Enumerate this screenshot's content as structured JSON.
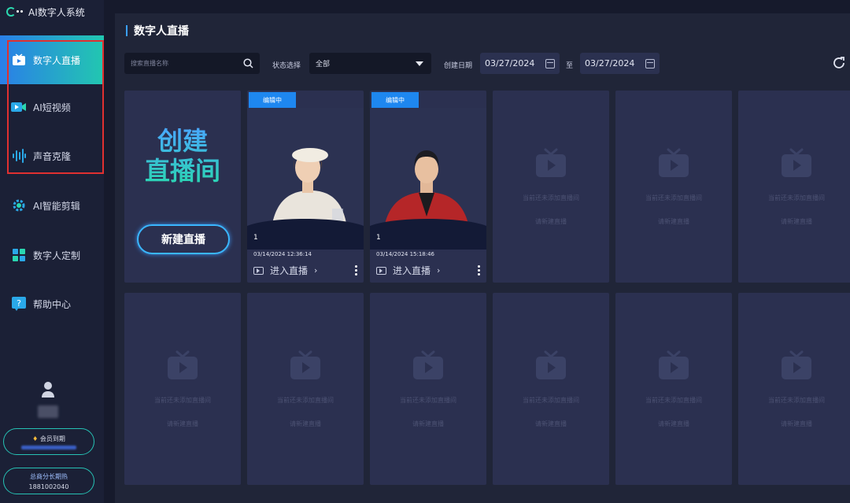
{
  "app": {
    "title": "AI数字人系统"
  },
  "sidebar": {
    "items": [
      {
        "label": "数字人直播",
        "icon": "live-tv-icon"
      },
      {
        "label": "AI短视频",
        "icon": "video-camera-icon"
      },
      {
        "label": "声音克隆",
        "icon": "sound-wave-icon"
      },
      {
        "label": "AI智能剪辑",
        "icon": "gear-icon"
      },
      {
        "label": "数字人定制",
        "icon": "puzzle-icon"
      },
      {
        "label": "帮助中心",
        "icon": "help-icon"
      }
    ],
    "membership": "会员到期",
    "contact_line1": "总商分长期热",
    "contact_line2": "1881002040"
  },
  "page": {
    "title": "数字人直播"
  },
  "filters": {
    "search_placeholder": "搜索直播名称",
    "select_label": "状态选择",
    "select_value": "全部",
    "date_label": "创建日期",
    "date_start": "03/27/2024",
    "date_separator": "至",
    "date_end": "03/27/2024"
  },
  "create_card": {
    "title_line1": "创建",
    "title_line2": "直播间",
    "button": "新建直播"
  },
  "live_cards": [
    {
      "badge": "编辑中",
      "number": "1",
      "time": "03/14/2024 12:36:14",
      "enter_label": "进入直播"
    },
    {
      "badge": "编辑中",
      "number": "1",
      "time": "03/14/2024 15:18:46",
      "enter_label": "进入直播"
    }
  ],
  "empty_card": {
    "line1": "当前还未添加直播间",
    "line2": "请新建直播"
  },
  "colors": {
    "accent_start": "#2a7fe8",
    "accent_end": "#22c7b0",
    "badge": "#1e87f0",
    "highlight_box": "#e03030"
  }
}
